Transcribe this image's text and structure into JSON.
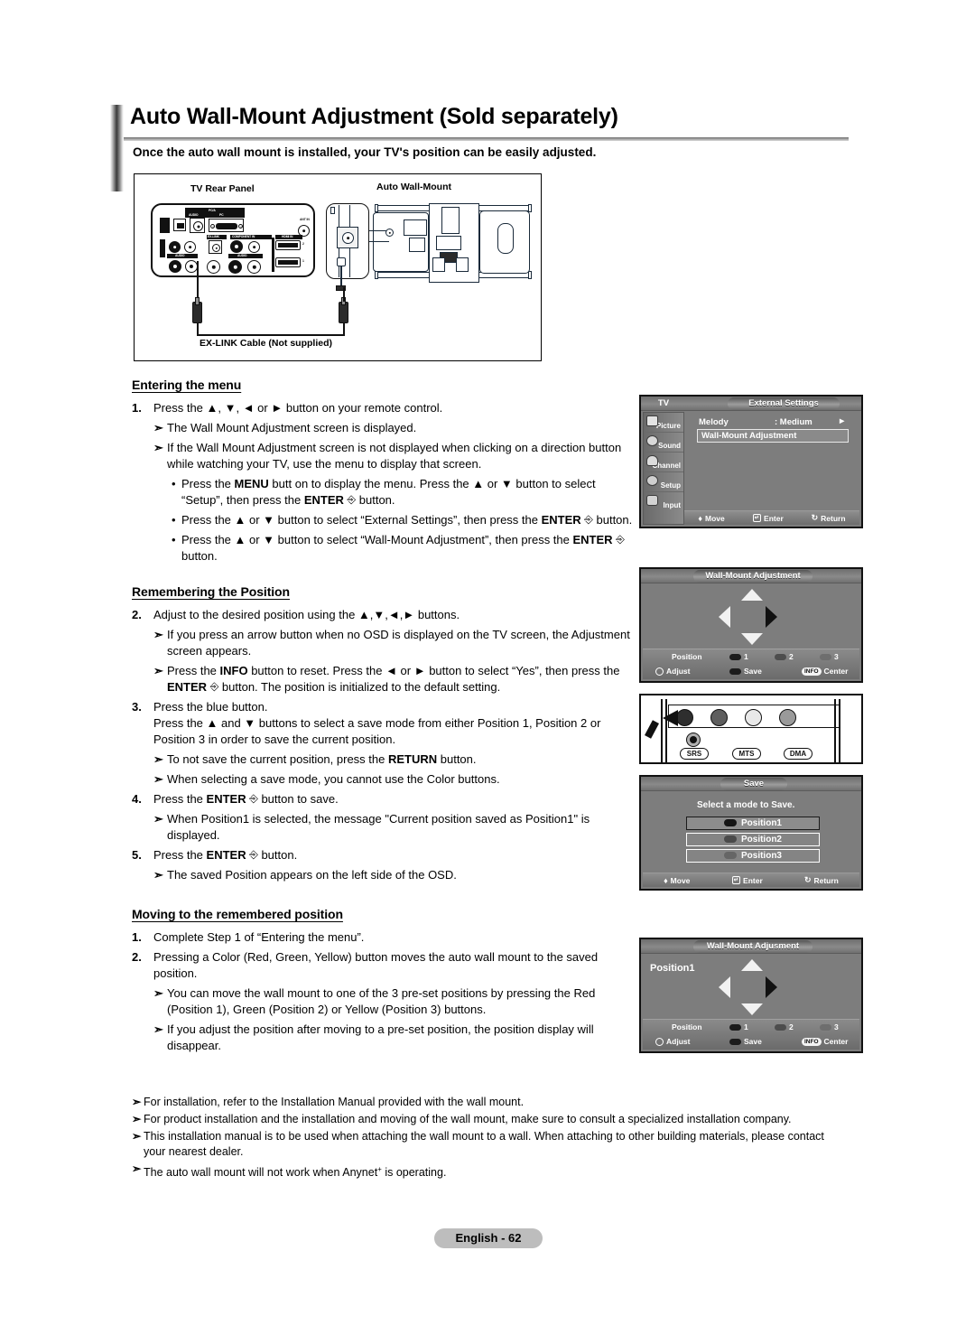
{
  "page": {
    "title": "Auto Wall-Mount Adjustment (Sold separately)",
    "intro": "Once the auto wall mount is installed, your TV's position can be easily adjusted.",
    "footer_label": "English - 62"
  },
  "diagram": {
    "tv_rear_panel_label": "TV Rear Panel",
    "auto_wall_mount_label": "Auto Wall-Mount",
    "cable_label": "EX-LINK Cable (Not supplied)",
    "panel_port_labels": {
      "pc_group": "PC/A",
      "audio": "AUDIO",
      "pc": "PC",
      "exlink": "EX-LINK",
      "component": "COMPONENT IN",
      "hdmi": "HDMI IN",
      "ant_in": "ANT IN",
      "digital_audio_out": "DIGITAL AUDIO OUT (OPTICAL)",
      "av_in": "AV IN",
      "audio_small": "AUDIO",
      "hdmi2": "2",
      "hdmi1": "1"
    }
  },
  "sections": {
    "entering_menu": {
      "heading": "Entering the menu",
      "steps": [
        {
          "num": "1.",
          "text": "Press the ▲, ▼, ◄ or ► button on your remote control.",
          "notes": [
            "The Wall Mount Adjustment screen is displayed.",
            "If the Wall Mount Adjustment screen is not displayed when clicking on a direction button while watching your TV, use the menu to display that screen."
          ],
          "bullets": [
            "Press the MENU butt on to display the menu. Press the ▲ or ▼ button to select “Setup”, then press the ENTER ⏎ button.",
            "Press the ▲ or ▼ button to select “External Settings”, then press the ENTER ⏎ button.",
            "Press the ▲ or ▼ button to select “Wall-Mount Adjustment”, then press the ENTER ⏎ button."
          ]
        }
      ]
    },
    "remembering_position": {
      "heading": "Remembering the Position",
      "step2_num": "2.",
      "step2_text": "Adjust to the desired position using the ▲,▼,◄,► buttons.",
      "step2_notes": [
        "If you press an arrow button when no OSD is displayed on the TV screen, the Adjustment screen appears.",
        "Press the INFO button to reset. Press the ◄ or ► button to select “Yes”, then press the ENTER ⏎ button. The position is initialized to the default setting."
      ],
      "step3_num": "3.",
      "step3_text_line1": "Press the blue button.",
      "step3_text_line2": "Press the ▲ and ▼ buttons to select a save mode from either Position 1, Position 2 or Position 3 in order to save the current position.",
      "step3_notes": [
        "To not save the current position, press the RETURN button.",
        "When selecting a save mode, you cannot use the Color buttons."
      ],
      "step4_num": "4.",
      "step4_text": "Press the ENTER ⏎ button to save.",
      "step4_notes": [
        "When Position1 is selected, the message \"Current position saved as Position1\" is displayed."
      ],
      "step5_num": "5.",
      "step5_text": "Press the ENTER ⏎ button.",
      "step5_notes": [
        "The saved Position appears on the left side of the OSD."
      ]
    },
    "moving_to_position": {
      "heading": "Moving to the remembered position",
      "step1_num": "1.",
      "step1_text": "Complete Step 1 of “Entering the menu”.",
      "step2_num": "2.",
      "step2_text": "Pressing a Color (Red, Green, Yellow) button moves the auto wall mount to the saved position.",
      "step2_notes": [
        "You can move the wall mount to one of the 3 pre-set positions by pressing the Red (Position 1), Green (Position 2) or Yellow (Position 3) buttons.",
        "If you adjust the position after moving to a pre-set position, the position display will disappear."
      ]
    },
    "final_notes": [
      "For installation, refer to the Installation Manual provided with the wall mount.",
      "For product installation and the installation and moving of the wall mount, make sure to consult a specialized installation company.",
      "This installation manual is to be used when attaching the wall mount to a wall. When attaching to other building materials, please contact your nearest dealer.",
      "The auto wall mount will not work when Anynet+ is operating."
    ]
  },
  "osd_external_settings": {
    "tv_label": "TV",
    "title": "External Settings",
    "sidebar": [
      "Picture",
      "Sound",
      "Channel",
      "Setup",
      "Input"
    ],
    "melody_label": "Melody",
    "melody_value": ": Medium",
    "melody_arrow": "►",
    "selected_item": "Wall-Mount Adjustment",
    "hints": {
      "move": "Move",
      "enter": "Enter",
      "return": "Return"
    }
  },
  "osd_wall_mount_adjustment": {
    "title": "Wall-Mount Adjustment",
    "position_label": "Position",
    "pos1": "1",
    "pos2": "2",
    "pos3": "3",
    "adjust_label": "Adjust",
    "save_label": "Save",
    "info_label": "INFO",
    "center_label": "Center"
  },
  "button_strip": {
    "srs": "SRS",
    "mts": "MTS",
    "dma": "DMA",
    "knob_colors": [
      "#2e2e2e",
      "#5e5e5e",
      "#e8e8e8",
      "#9a9a9a"
    ]
  },
  "osd_save": {
    "title": "Save",
    "prompt": "Select a mode to Save.",
    "items": [
      "Position1",
      "Position2",
      "Position3"
    ],
    "hints": {
      "move": "Move",
      "enter": "Enter",
      "return": "Return"
    }
  },
  "osd_wall_mount_adjusment_saved": {
    "title": "Wall-Mount Adjusment",
    "position_display": "Position1",
    "position_label": "Position",
    "pos1": "1",
    "pos2": "2",
    "pos3": "3",
    "adjust_label": "Adjust",
    "save_label": "Save",
    "info_label": "INFO",
    "center_label": "Center"
  }
}
